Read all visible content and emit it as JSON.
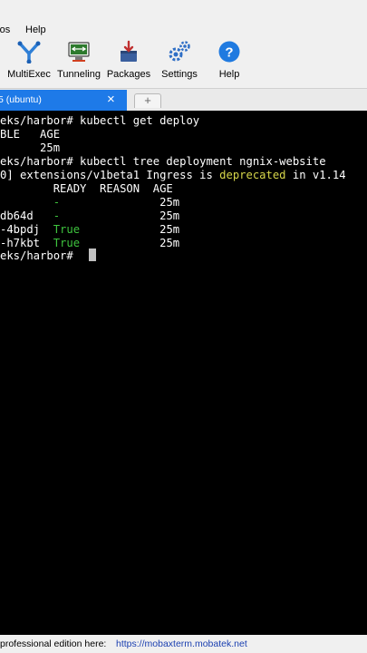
{
  "menubar": {
    "items": [
      "ros",
      "Help"
    ]
  },
  "toolbar": {
    "buttons": [
      {
        "label": "MultiExec",
        "icon": "multiexec-icon"
      },
      {
        "label": "Tunneling",
        "icon": "tunneling-icon"
      },
      {
        "label": "Packages",
        "icon": "packages-icon"
      },
      {
        "label": "Settings",
        "icon": "settings-icon"
      },
      {
        "label": "Help",
        "icon": "help-icon"
      }
    ]
  },
  "tabs": {
    "active_label": "5 (ubuntu)",
    "close_glyph": "×",
    "new_tab_glyph": "+"
  },
  "terminal": {
    "lines": [
      {
        "segments": [
          {
            "text": "eks/harbor# kubectl get deploy"
          }
        ]
      },
      {
        "segments": [
          {
            "text": "BLE   AGE"
          }
        ]
      },
      {
        "segments": [
          {
            "text": "      25m"
          }
        ]
      },
      {
        "segments": [
          {
            "text": "eks/harbor# kubectl tree deployment ngnix-website"
          }
        ]
      },
      {
        "segments": [
          {
            "text": "0] extensions/v1beta1 Ingress is "
          },
          {
            "text": "deprecated",
            "color": "yellow"
          },
          {
            "text": " in v1.14"
          }
        ]
      },
      {
        "segments": [
          {
            "text": "        READY  REASON  AGE"
          }
        ]
      },
      {
        "segments": [
          {
            "text": "        "
          },
          {
            "text": "-",
            "color": "green"
          },
          {
            "text": "               25m"
          }
        ]
      },
      {
        "segments": [
          {
            "text": "db64d   "
          },
          {
            "text": "-",
            "color": "green"
          },
          {
            "text": "               25m"
          }
        ]
      },
      {
        "segments": [
          {
            "text": "-4bpdj  "
          },
          {
            "text": "True",
            "color": "green"
          },
          {
            "text": "            25m"
          }
        ]
      },
      {
        "segments": [
          {
            "text": "-h7kbt  "
          },
          {
            "text": "True",
            "color": "green"
          },
          {
            "text": "            25m"
          }
        ]
      },
      {
        "segments": [
          {
            "text": "eks/harbor# "
          }
        ]
      }
    ]
  },
  "statusbar": {
    "text": " professional edition here:",
    "link": "https://mobaxterm.mobatek.net"
  },
  "colors": {
    "accent": "#1e7ae8",
    "terminal_bg": "#000000",
    "green": "#3ec43e",
    "yellow": "#d6d64a",
    "link": "#1a3fb0"
  }
}
